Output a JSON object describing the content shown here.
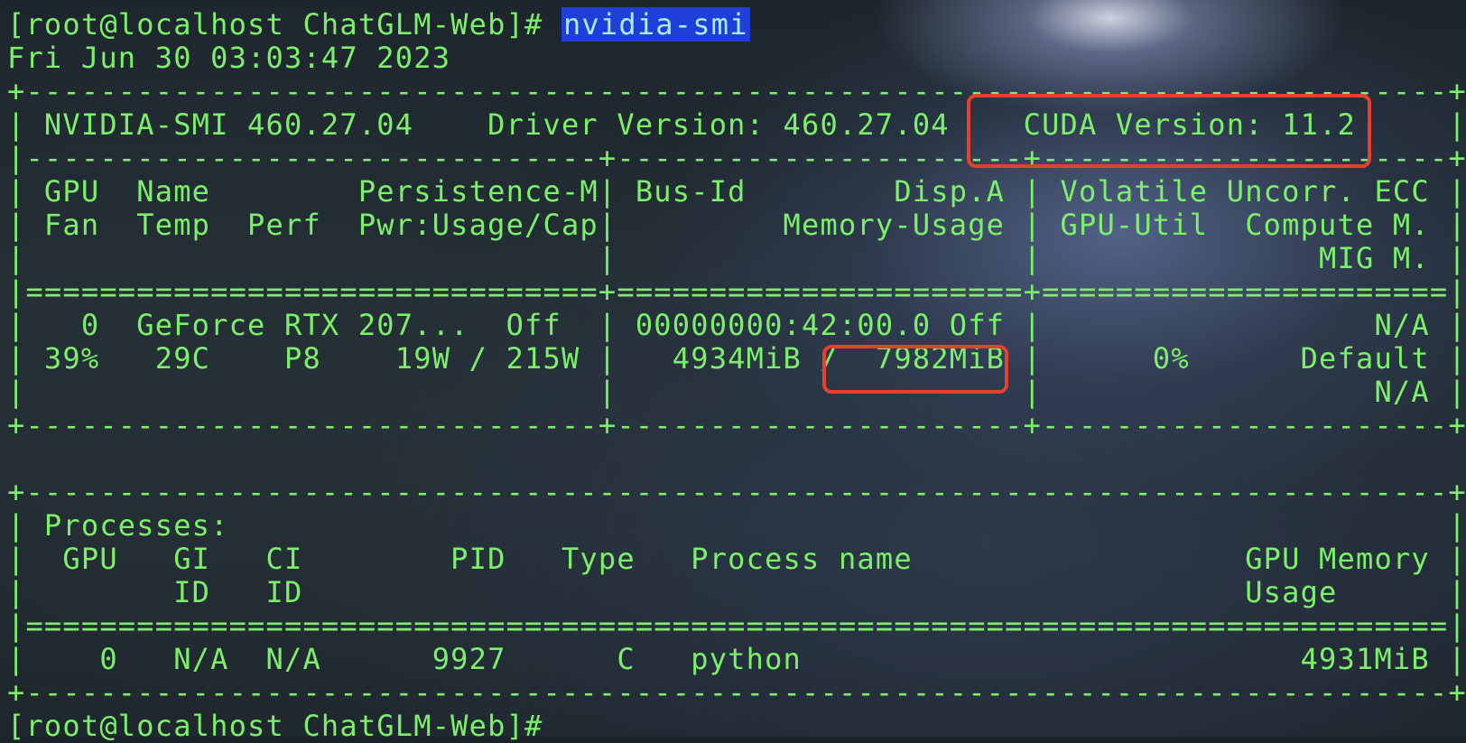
{
  "terminal": {
    "prompt": "[root@localhost ChatGLM-Web]# ",
    "command": "nvidia-smi",
    "timestamp": "Fri Jun 30 03:03:47 2023",
    "lines": [
      "+-----------------------------------------------------------------------------+",
      "| NVIDIA-SMI 460.27.04    Driver Version: 460.27.04    CUDA Version: 11.2     |",
      "|-------------------------------+----------------------+----------------------+",
      "| GPU  Name        Persistence-M| Bus-Id        Disp.A | Volatile Uncorr. ECC |",
      "| Fan  Temp  Perf  Pwr:Usage/Cap|         Memory-Usage | GPU-Util  Compute M. |",
      "|                               |                      |               MIG M. |",
      "|===============================+======================+======================|",
      "|   0  GeForce RTX 207...  Off  | 00000000:42:00.0 Off |                  N/A |",
      "| 39%   29C    P8    19W / 215W |   4934MiB /  7982MiB |      0%      Default |",
      "|                               |                      |                  N/A |",
      "+-------------------------------+----------------------+----------------------+",
      "",
      "+-----------------------------------------------------------------------------+",
      "| Processes:                                                                  |",
      "|  GPU   GI   CI        PID   Type   Process name                  GPU Memory |",
      "|        ID   ID                                                   Usage      |",
      "|=============================================================================|",
      "|    0   N/A  N/A      9927      C   python                           4931MiB |",
      "+-----------------------------------------------------------------------------+"
    ],
    "next_prompt": "[root@localhost ChatGLM-Web]#"
  },
  "colors": {
    "text": "#7cf06a",
    "command_highlight_bg": "#1f3fd8",
    "command_highlight_fg": "#a8ecff",
    "annotation": "#e8402e"
  },
  "annotations": [
    "cuda-version-highlight",
    "total-memory-highlight"
  ]
}
